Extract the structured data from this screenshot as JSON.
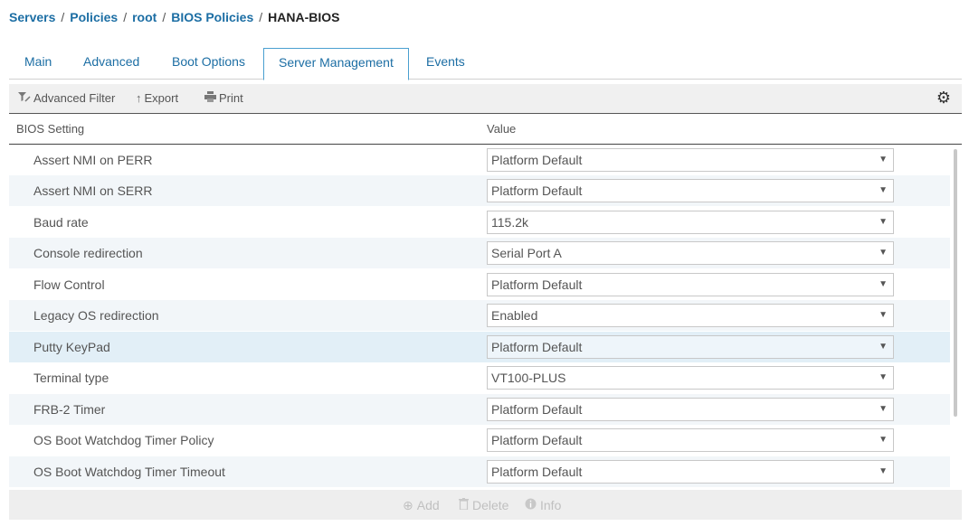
{
  "breadcrumb": {
    "items": [
      "Servers",
      "Policies",
      "root",
      "BIOS Policies"
    ],
    "separator": "/",
    "current": "HANA-BIOS"
  },
  "tabs": [
    {
      "label": "Main"
    },
    {
      "label": "Advanced"
    },
    {
      "label": "Boot Options"
    },
    {
      "label": "Server Management",
      "active": true
    },
    {
      "label": "Events"
    }
  ],
  "toolbar": {
    "advanced_filter": "Advanced Filter",
    "export": "Export",
    "print": "Print",
    "settings_icon": "gear-icon"
  },
  "table": {
    "headers": {
      "setting": "BIOS Setting",
      "value": "Value"
    },
    "rows": [
      {
        "setting": "Assert NMI on PERR",
        "value": "Platform Default"
      },
      {
        "setting": "Assert NMI on SERR",
        "value": "Platform Default"
      },
      {
        "setting": "Baud rate",
        "value": "115.2k"
      },
      {
        "setting": "Console redirection",
        "value": "Serial Port A"
      },
      {
        "setting": "Flow Control",
        "value": "Platform Default"
      },
      {
        "setting": "Legacy OS redirection",
        "value": "Enabled"
      },
      {
        "setting": "Putty KeyPad",
        "value": "Platform Default",
        "highlighted": true
      },
      {
        "setting": "Terminal type",
        "value": "VT100-PLUS"
      },
      {
        "setting": "FRB-2 Timer",
        "value": "Platform Default"
      },
      {
        "setting": "OS Boot Watchdog Timer Policy",
        "value": "Platform Default"
      },
      {
        "setting": "OS Boot Watchdog Timer Timeout",
        "value": "Platform Default"
      }
    ]
  },
  "footer": {
    "add": "Add",
    "delete": "Delete",
    "info": "Info"
  },
  "colors": {
    "link": "#1c6ea4",
    "row_alt": "#f2f6f9",
    "row_highlight": "#e2eff7",
    "tab_active_border": "#4a9fd0"
  }
}
